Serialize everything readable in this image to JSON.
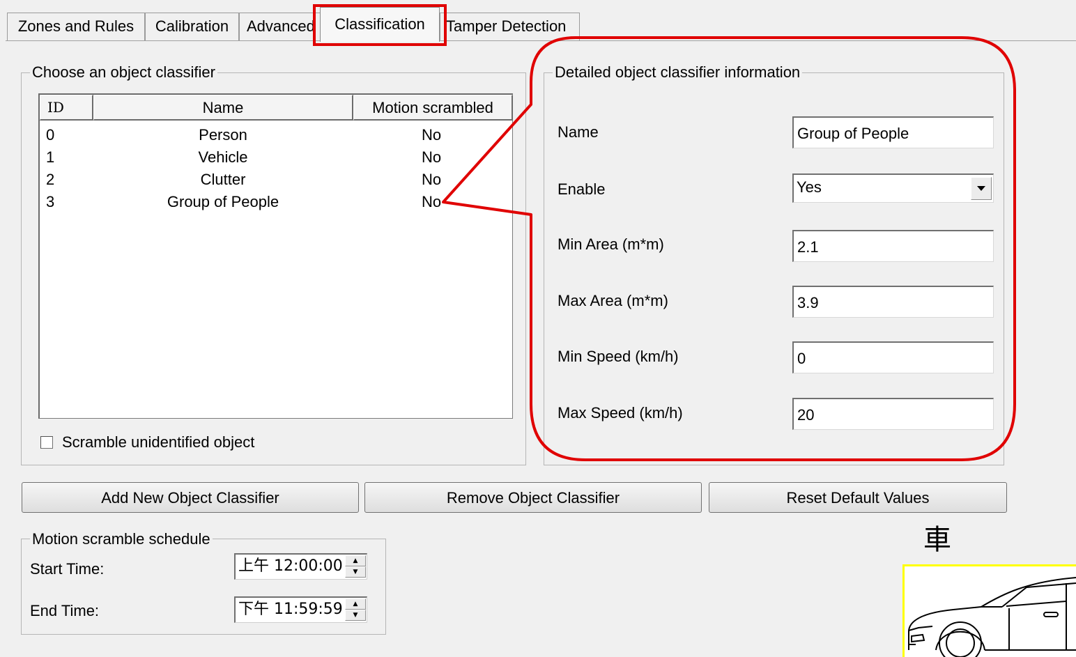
{
  "tabs": [
    {
      "label": "Zones and Rules"
    },
    {
      "label": "Calibration"
    },
    {
      "label": "Advanced"
    },
    {
      "label": "Classification"
    },
    {
      "label": "Tamper Detection"
    }
  ],
  "active_tab": "Classification",
  "classifier_list": {
    "legend": "Choose an object classifier",
    "columns": [
      "ID",
      "Name",
      "Motion scrambled"
    ],
    "rows": [
      {
        "id": "0",
        "name": "Person",
        "motion": "No"
      },
      {
        "id": "1",
        "name": "Vehicle",
        "motion": "No"
      },
      {
        "id": "2",
        "name": "Clutter",
        "motion": "No"
      },
      {
        "id": "3",
        "name": "Group of People",
        "motion": "No"
      }
    ],
    "scramble_checkbox_label": "Scramble unidentified object",
    "scramble_checked": false
  },
  "details": {
    "legend": "Detailed object classifier information",
    "name_label": "Name",
    "name_value": "Group of People",
    "enable_label": "Enable",
    "enable_value": "Yes",
    "min_area_label": "Min Area (m*m)",
    "min_area_value": "2.1",
    "max_area_label": "Max Area (m*m)",
    "max_area_value": "3.9",
    "min_speed_label": "Min Speed (km/h)",
    "min_speed_value": "0",
    "max_speed_label": "Max Speed (km/h)",
    "max_speed_value": "20"
  },
  "buttons": {
    "add": "Add New Object Classifier",
    "remove": "Remove Object Classifier",
    "reset": "Reset Default Values"
  },
  "schedule": {
    "legend": "Motion scramble schedule",
    "start_label": "Start Time:",
    "start_value": "上午 12:00:00",
    "end_label": "End Time:",
    "end_value": "下午 11:59:59"
  },
  "vehicle_thumbnail": {
    "caption": "車",
    "icon": "car-icon",
    "border_color": "#ffff00"
  },
  "annotation": {
    "color": "#e00000"
  }
}
